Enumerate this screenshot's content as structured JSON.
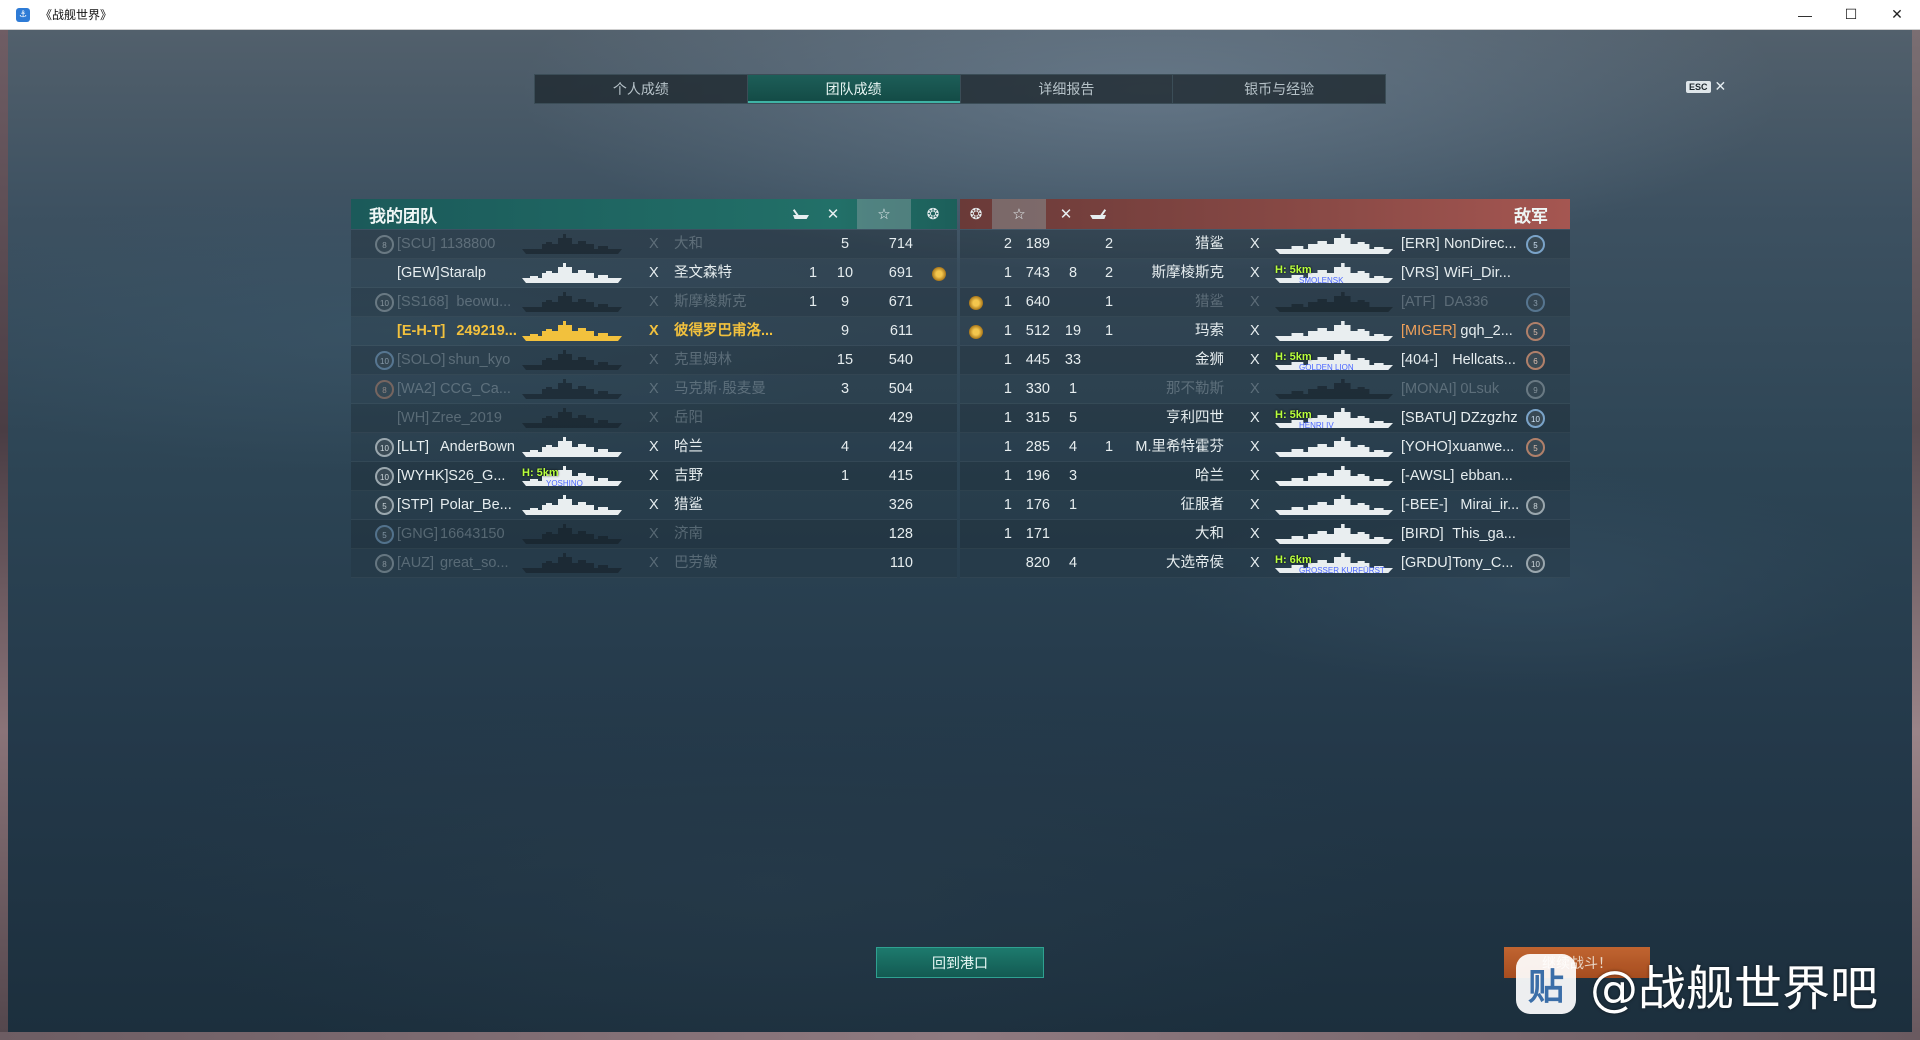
{
  "window": {
    "title": "《战舰世界》",
    "controls": [
      "—",
      "☐",
      "✕"
    ]
  },
  "tabs": [
    {
      "label": "个人成绩",
      "active": false
    },
    {
      "label": "团队成绩",
      "active": true
    },
    {
      "label": "详细报告",
      "active": false
    },
    {
      "label": "银币与经验",
      "active": false
    }
  ],
  "esc": {
    "key": "ESC",
    "close": "✕"
  },
  "my_team": {
    "title": "我的团队",
    "header_icons": [
      "ship-kills-icon",
      "aircraft-kills-icon",
      "star-icon",
      "laurel-icon"
    ],
    "players": [
      {
        "level": "8",
        "badge": "gray",
        "clan": "[SCU]",
        "name": "1138800",
        "alive": false,
        "x": "X",
        "ship": "大和",
        "planes": "",
        "kills": "5",
        "xp": "714",
        "medal": false
      },
      {
        "level": "",
        "badge": "none",
        "clan": "[GEW]",
        "name": "Staralp",
        "alive": true,
        "x": "X",
        "ship": "圣文森特",
        "planes": "1",
        "kills": "10",
        "xp": "691",
        "medal": true
      },
      {
        "level": "10",
        "badge": "gray",
        "clan": "[SS168]",
        "name": "beowu...",
        "alive": false,
        "x": "X",
        "ship": "斯摩棱斯克",
        "planes": "1",
        "kills": "9",
        "xp": "671",
        "medal": false
      },
      {
        "level": "",
        "badge": "none",
        "clan": "[E-H-T]",
        "name": "249219...",
        "alive": true,
        "me": true,
        "x": "X",
        "ship": "彼得罗巴甫洛...",
        "planes": "",
        "kills": "9",
        "xp": "611",
        "medal": false
      },
      {
        "level": "10",
        "badge": "blue",
        "clan": "[SOLO]",
        "name": "shun_kyo",
        "alive": false,
        "x": "X",
        "ship": "克里姆林",
        "planes": "",
        "kills": "15",
        "xp": "540",
        "medal": false
      },
      {
        "level": "8",
        "badge": "bronze",
        "clan": "[WA2]",
        "name": "CCG_Ca...",
        "alive": false,
        "x": "X",
        "ship": "马克斯·殷麦曼",
        "planes": "",
        "kills": "3",
        "xp": "504",
        "medal": false
      },
      {
        "level": "",
        "badge": "none",
        "clan": "[WH]",
        "name": "Zree_2019",
        "alive": false,
        "x": "X",
        "ship": "岳阳",
        "planes": "",
        "kills": "",
        "xp": "429",
        "medal": false
      },
      {
        "level": "10",
        "badge": "gray",
        "clan": "[LLT]",
        "name": "AnderBown",
        "alive": true,
        "x": "X",
        "ship": "哈兰",
        "planes": "",
        "kills": "4",
        "xp": "424",
        "medal": false
      },
      {
        "level": "10",
        "badge": "gray",
        "clan": "[WYHK]",
        "name": "S26_G...",
        "alive": true,
        "spotted": true,
        "spot_range": "H: 5km",
        "spot_ship": "YOSHINO",
        "x": "X",
        "ship": "吉野",
        "planes": "",
        "kills": "1",
        "xp": "415",
        "medal": false
      },
      {
        "level": "5",
        "badge": "gray",
        "clan": "[STP]",
        "name": "Polar_Be...",
        "alive": true,
        "x": "X",
        "ship": "猎鲨",
        "planes": "",
        "kills": "",
        "xp": "326",
        "medal": false
      },
      {
        "level": "5",
        "badge": "blue",
        "clan": "[GNG]",
        "name": "16643150",
        "alive": false,
        "x": "X",
        "ship": "济南",
        "planes": "",
        "kills": "",
        "xp": "128",
        "medal": false
      },
      {
        "level": "8",
        "badge": "gray",
        "clan": "[AUZ]",
        "name": "great_so...",
        "alive": false,
        "x": "X",
        "ship": "巴劳鲅",
        "planes": "",
        "kills": "",
        "xp": "110",
        "medal": false
      }
    ]
  },
  "enemy_team": {
    "title": "敌军",
    "header_icons": [
      "laurel-icon",
      "star-icon",
      "aircraft-kills-icon",
      "ship-kills-icon"
    ],
    "players": [
      {
        "medal": false,
        "rank": "2",
        "xp": "189",
        "planes": "",
        "kills": "2",
        "ship": "猎鲨",
        "x": "X",
        "clan": "[ERR]",
        "name": "NonDirec...",
        "level": "5",
        "badge": "blue",
        "alive": true
      },
      {
        "medal": false,
        "rank": "1",
        "xp": "743",
        "planes": "8",
        "kills": "2",
        "ship": "斯摩棱斯克",
        "x": "X",
        "clan": "[VRS]",
        "name": "WiFi_Dir...",
        "level": "",
        "badge": "none",
        "alive": true,
        "spotted": true,
        "spot_range": "H: 5km",
        "spot_ship": "SMOLENSK"
      },
      {
        "medal": true,
        "rank": "1",
        "xp": "640",
        "planes": "",
        "kills": "1",
        "ship": "猎鲨",
        "x": "X",
        "clan": "[ATF]",
        "name": "DA336",
        "level": "3",
        "badge": "blue",
        "alive": false
      },
      {
        "medal": true,
        "rank": "1",
        "xp": "512",
        "planes": "19",
        "kills": "1",
        "ship": "玛索",
        "x": "X",
        "clan": "[MIGER]",
        "name": "gqh_2...",
        "level": "5",
        "badge": "bronze",
        "alive": true,
        "warn": true
      },
      {
        "medal": false,
        "rank": "1",
        "xp": "445",
        "planes": "33",
        "kills": "",
        "ship": "金狮",
        "x": "X",
        "clan": "[404-]",
        "name": "Hellcats...",
        "level": "6",
        "badge": "bronze",
        "alive": true,
        "spotted": true,
        "spot_range": "H: 5km",
        "spot_ship": "GOLDEN LION"
      },
      {
        "medal": false,
        "rank": "1",
        "xp": "330",
        "planes": "1",
        "kills": "",
        "ship": "那不勒斯",
        "x": "X",
        "clan": "[MONAI]",
        "name": "0Lsuk",
        "level": "9",
        "badge": "gray",
        "alive": false
      },
      {
        "medal": false,
        "rank": "1",
        "xp": "315",
        "planes": "5",
        "kills": "",
        "ship": "亨利四世",
        "x": "X",
        "clan": "[SBATU]",
        "name": "DZzgzhz",
        "level": "10",
        "badge": "blue",
        "alive": true,
        "spotted": true,
        "spot_range": "H: 5km",
        "spot_ship": "HENRI IV"
      },
      {
        "medal": false,
        "rank": "1",
        "xp": "285",
        "planes": "4",
        "kills": "1",
        "ship": "M.里希特霍芬",
        "x": "X",
        "clan": "[YOHO]",
        "name": "xuanwe...",
        "level": "5",
        "badge": "bronze",
        "alive": true
      },
      {
        "medal": false,
        "rank": "1",
        "xp": "196",
        "planes": "3",
        "kills": "",
        "ship": "哈兰",
        "x": "X",
        "clan": "[-AWSL]",
        "name": "ebban...",
        "level": "",
        "badge": "none",
        "alive": true
      },
      {
        "medal": false,
        "rank": "1",
        "xp": "176",
        "planes": "1",
        "kills": "",
        "ship": "征服者",
        "x": "X",
        "clan": "[-BEE-]",
        "name": "Mirai_ir...",
        "level": "8",
        "badge": "gray",
        "alive": true
      },
      {
        "medal": false,
        "rank": "1",
        "xp": "171",
        "planes": "",
        "kills": "",
        "ship": "大和",
        "x": "X",
        "clan": "[BIRD]",
        "name": "This_ga...",
        "level": "",
        "badge": "none",
        "alive": true
      },
      {
        "medal": false,
        "rank": "",
        "xp": "820",
        "planes": "4",
        "kills": "",
        "ship": "大选帝侯",
        "x": "X",
        "clan": "[GRDU]",
        "name": "Tony_C...",
        "level": "10",
        "badge": "gray",
        "alive": true,
        "spotted": true,
        "spot_range": "H: 6km",
        "spot_ship": "GROSSER KURFÜRST"
      }
    ]
  },
  "buttons": {
    "back_to_port": "回到港口",
    "continue_battle": "继续战斗！"
  },
  "watermark": {
    "logo": "贴",
    "text": "@战舰世界吧"
  },
  "colors": {
    "my_team_header": "#227068",
    "enemy_header": "#8a4a46",
    "self_highlight": "#f2c13d",
    "active_tab": "#1d5e58",
    "back_button": "#1d7a6d",
    "continue_button": "#d26a2f"
  }
}
